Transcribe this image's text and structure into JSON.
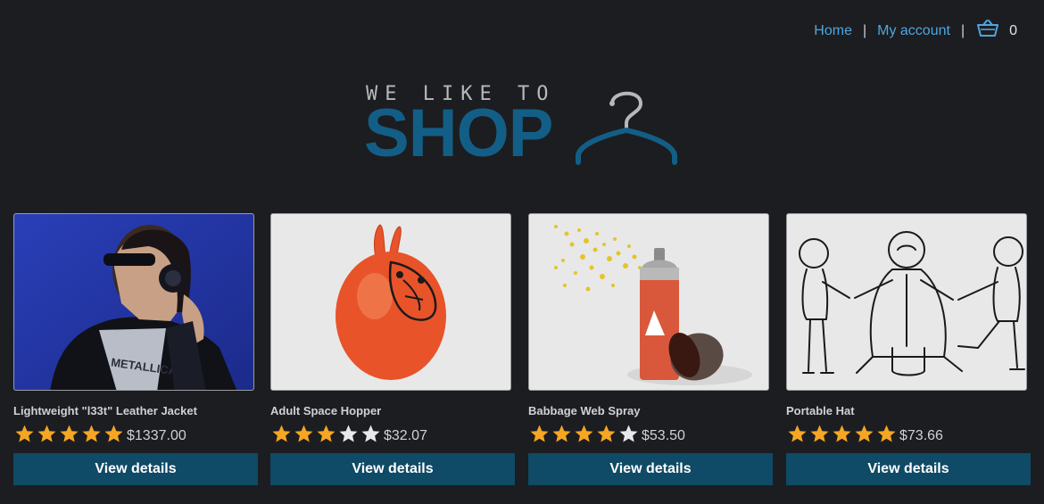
{
  "nav": {
    "home_label": "Home",
    "separator": "|",
    "account_label": "My account",
    "cart_icon": "basket-icon",
    "cart_count": "0"
  },
  "logo": {
    "tagline": "WE LIKE TO",
    "word": "SHOP",
    "icon": "hanger-icon",
    "colors": {
      "word": "#135e86",
      "tagline": "#b6b8bb",
      "hanger_hook": "#b6b8bb",
      "hanger_bar": "#135e86"
    }
  },
  "products": [
    {
      "name": "Lightweight \"l33t\" Leather Jacket",
      "rating": 5,
      "price": "$1337.00",
      "button_label": "View details",
      "image": "woman-with-headphones-photo"
    },
    {
      "name": "Adult Space Hopper",
      "rating": 3,
      "price": "$32.07",
      "button_label": "View details",
      "image": "orange-space-hopper-illustration"
    },
    {
      "name": "Babbage Web Spray",
      "rating": 4,
      "price": "$53.50",
      "button_label": "View details",
      "image": "spray-can-illustration"
    },
    {
      "name": "Portable Hat",
      "rating": 5,
      "price": "$73.66",
      "button_label": "View details",
      "image": "men-pulling-hat-sketch"
    }
  ],
  "colors": {
    "background": "#1c1d20",
    "link": "#4ea6e0",
    "button": "#0f4a66",
    "star_filled": "#f5a623",
    "star_empty": "#e6e9ec"
  }
}
